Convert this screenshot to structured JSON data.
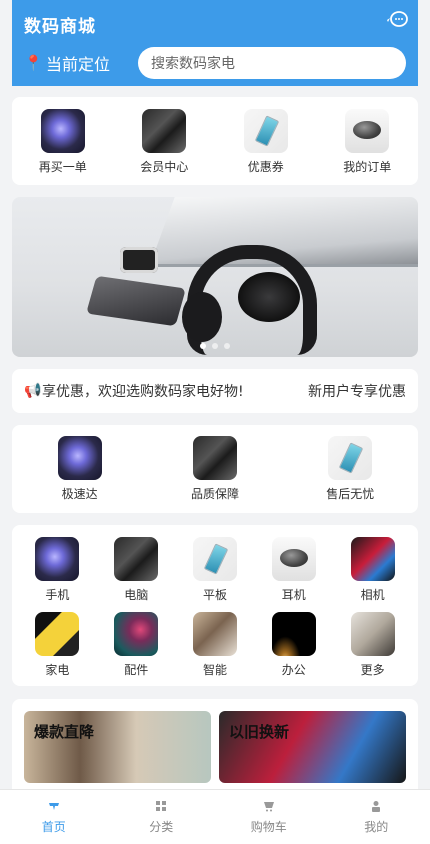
{
  "header": {
    "title": "数码商城",
    "location_label": "当前定位",
    "search_placeholder": "搜索数码家电",
    "bg_color": "#3d9be9"
  },
  "quick_actions": [
    {
      "label": "再买一单",
      "icon": "storm-thumb"
    },
    {
      "label": "会员中心",
      "icon": "dark-thumb"
    },
    {
      "label": "优惠券",
      "icon": "phone-thumb"
    },
    {
      "label": "我的订单",
      "icon": "mouse-thumb"
    }
  ],
  "banner": {
    "slides": 3,
    "active_index": 0
  },
  "notice": {
    "text": "享优惠，欢迎选购数码家电好物!",
    "link": "新用户专享优惠"
  },
  "features": [
    {
      "label": "极速达"
    },
    {
      "label": "品质保障"
    },
    {
      "label": "售后无忧"
    }
  ],
  "categories": [
    {
      "label": "手机"
    },
    {
      "label": "电脑"
    },
    {
      "label": "平板"
    },
    {
      "label": "耳机"
    },
    {
      "label": "相机"
    },
    {
      "label": "家电"
    },
    {
      "label": "配件"
    },
    {
      "label": "智能"
    },
    {
      "label": "办公"
    },
    {
      "label": "更多"
    }
  ],
  "promos": [
    {
      "label": "爆款直降"
    },
    {
      "label": "以旧换新"
    }
  ],
  "tabbar": [
    {
      "label": "首页",
      "active": true
    },
    {
      "label": "分类",
      "active": false
    },
    {
      "label": "购物车",
      "active": false
    },
    {
      "label": "我的",
      "active": false
    }
  ]
}
